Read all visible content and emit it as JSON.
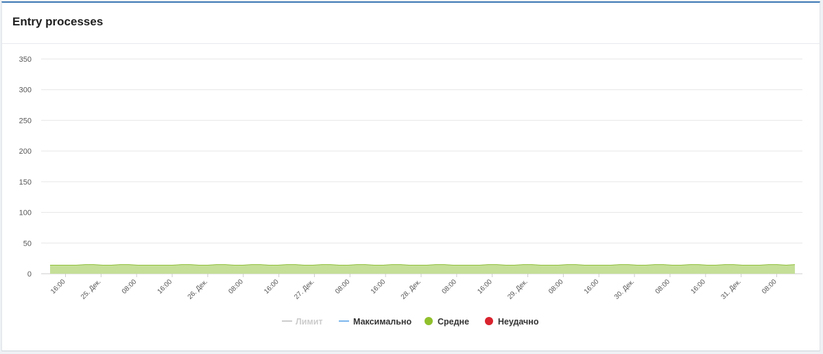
{
  "panel": {
    "title": "Entry processes"
  },
  "colors": {
    "limit": "#cccccc",
    "max": "#7cb5ec",
    "avg_fill": "#c5df98",
    "avg_line": "#8fbf3a",
    "avg_dot": "#90c02c",
    "fail": "#d9232e",
    "grid": "#e6e6e6",
    "axis_text": "#555555"
  },
  "chart_data": {
    "type": "area",
    "title": "Entry processes",
    "ylim": [
      0,
      350
    ],
    "yticks": [
      "0",
      "50",
      "100",
      "150",
      "200",
      "250",
      "300",
      "350"
    ],
    "grid": true,
    "legend_position": "bottom-center",
    "x_tick_labels": [
      "16:00",
      "25. Дек.",
      "08:00",
      "16:00",
      "26. Дек.",
      "08:00",
      "16:00",
      "27. Дек.",
      "08:00",
      "16:00",
      "28. Дек.",
      "08:00",
      "16:00",
      "29. Дек.",
      "08:00",
      "16:00",
      "30. Дек.",
      "08:00",
      "16:00",
      "31. Дек.",
      "08:00"
    ],
    "series": [
      {
        "name": "Лимит",
        "values": []
      },
      {
        "name": "Максимально",
        "values": []
      },
      {
        "name": "Средне",
        "values": [
          14,
          14,
          14,
          14,
          15,
          15,
          14,
          14,
          15,
          15,
          14,
          14,
          14,
          14,
          14,
          15,
          15,
          14,
          14,
          15,
          15,
          14,
          14,
          15,
          15,
          14,
          14,
          15,
          15,
          14,
          14,
          15,
          15,
          14,
          14,
          15,
          15,
          14,
          14,
          15,
          15,
          14,
          14,
          14,
          15,
          15,
          14,
          14,
          14,
          14,
          15,
          15,
          14,
          14,
          15,
          15,
          14,
          14,
          14,
          15,
          15,
          14,
          14,
          14,
          14,
          15,
          15,
          14,
          14,
          15,
          15,
          14,
          14,
          15,
          15,
          14,
          14,
          15,
          15,
          14,
          14,
          14,
          15,
          15,
          14,
          15
        ]
      },
      {
        "name": "Неудачно",
        "values": []
      }
    ]
  }
}
